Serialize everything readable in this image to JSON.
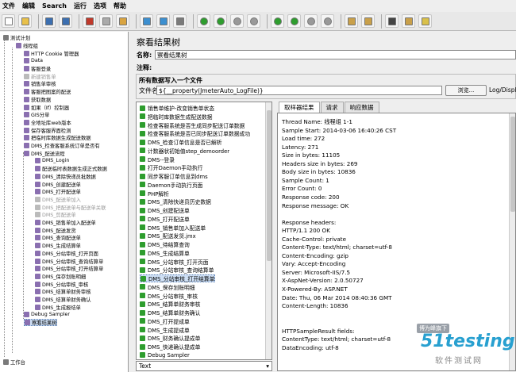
{
  "menu": {
    "file": "文件",
    "edit": "编辑",
    "search": "Search",
    "run": "运行",
    "options": "选项",
    "help": "帮助"
  },
  "toolbar": {
    "icons": [
      "new-icon",
      "open-icon",
      "save-icon",
      "save-as-icon",
      "cut-icon",
      "copy-icon",
      "paste-icon",
      "expand-icon",
      "collapse-icon",
      "toggle-icon",
      "start-icon",
      "start-no-pause-icon",
      "stop-icon",
      "shutdown-icon",
      "remote-start-icon",
      "remote-start-all-icon",
      "remote-stop-icon",
      "remote-shutdown-icon",
      "clear-icon",
      "clear-all-icon",
      "search-icon",
      "reset-search-icon",
      "function-helper-icon"
    ]
  },
  "tree": {
    "items": [
      {
        "label": "测试计划",
        "level": 0,
        "dim": false
      },
      {
        "label": "线程组",
        "level": 1,
        "dim": false
      },
      {
        "label": "HTTP Cookie 管理器",
        "level": 2,
        "dim": false
      },
      {
        "label": "Data",
        "level": 2,
        "dim": false
      },
      {
        "label": "客服登录",
        "level": 2,
        "dim": false
      },
      {
        "label": "新建销售单",
        "level": 2,
        "dim": true
      },
      {
        "label": "销售单审核",
        "level": 2,
        "dim": false
      },
      {
        "label": "客服把图案的配送",
        "level": 2,
        "dim": false
      },
      {
        "label": "获取数据",
        "level": 2,
        "dim": false
      },
      {
        "label": "如果（If）控制器",
        "level": 2,
        "dim": false
      },
      {
        "label": "GIS分单",
        "level": 2,
        "dim": false
      },
      {
        "label": "全地址库web版本",
        "level": 2,
        "dim": false
      },
      {
        "label": "保存客服界面检测",
        "level": 2,
        "dim": false
      },
      {
        "label": "把临时库数据生成配送数据",
        "level": 2,
        "dim": false
      },
      {
        "label": "DMS_检查客服系统订单是否有",
        "level": 2,
        "dim": false
      },
      {
        "label": "DMS_配送流程",
        "level": 2,
        "dim": false
      },
      {
        "label": "DMS_Login",
        "level": 3,
        "dim": false
      },
      {
        "label": "配送临时表数据生成正式数据",
        "level": 3,
        "dim": false
      },
      {
        "label": "DMS_清除快递员批数据",
        "level": 3,
        "dim": false
      },
      {
        "label": "DMS_创建配送单",
        "level": 3,
        "dim": false
      },
      {
        "label": "DMS_打开配送单",
        "level": 3,
        "dim": false
      },
      {
        "label": "DMS_配送单加入",
        "level": 3,
        "dim": true
      },
      {
        "label": "DMS_把配送单与配送单关联",
        "level": 3,
        "dim": true
      },
      {
        "label": "DMS_剪配送单",
        "level": 3,
        "dim": true
      },
      {
        "label": "DMS_销售单加入配送单",
        "level": 3,
        "dim": false
      },
      {
        "label": "DMS_配送发货",
        "level": 3,
        "dim": false
      },
      {
        "label": "DMS_查询配送单",
        "level": 3,
        "dim": false
      },
      {
        "label": "DMS_生成结算单",
        "level": 3,
        "dim": false
      },
      {
        "label": "DMS_分站审核_打开页面",
        "level": 3,
        "dim": false
      },
      {
        "label": "DMS_分站审核_查询结算单",
        "level": 3,
        "dim": false
      },
      {
        "label": "DMS_分站审核_打开结算单",
        "level": 3,
        "dim": false
      },
      {
        "label": "DMS_保存划账明细",
        "level": 3,
        "dim": false
      },
      {
        "label": "DMS_分站审核_审核",
        "level": 3,
        "dim": false
      },
      {
        "label": "DMS_结算单财务审核",
        "level": 3,
        "dim": false
      },
      {
        "label": "DMS_结算单财务确认",
        "level": 3,
        "dim": false
      },
      {
        "label": "DMS_生成报结单",
        "level": 3,
        "dim": false
      },
      {
        "label": "Debug Sampler",
        "level": 2,
        "dim": false
      },
      {
        "label": "察看结果树",
        "level": 2,
        "dim": false,
        "selected": true
      },
      {
        "label": "工作台",
        "level": 0,
        "dim": false
      }
    ]
  },
  "panel": {
    "title": "察看结果树",
    "name_label": "名称:",
    "name_value": "察看结果树",
    "comment_label": "注释:",
    "group_title": "所有数据写入一个文件",
    "file_label": "文件名",
    "file_value": "${__property(JmeterAuto_LogFile)}",
    "browse_button": "浏览...",
    "log_label": "Log/Display"
  },
  "results": {
    "items": [
      {
        "label": "销售单维护-改变销售单状态"
      },
      {
        "label": "把临时库数据生成配送数据"
      },
      {
        "label": "检查客服系统是否生成同步配送订单数据"
      },
      {
        "label": "检查客服系统是否已同步配送订单数据成功"
      },
      {
        "label": "DMS_检查订单信息是否已解析"
      },
      {
        "label": "计数器状初始值step_demoorder"
      },
      {
        "label": "DMS--登录"
      },
      {
        "label": "打开Daemon手动执行"
      },
      {
        "label": "同步客服订单信息到dms"
      },
      {
        "label": "Daemon手动执行页面"
      },
      {
        "label": "PHP解析"
      },
      {
        "label": "DMS_清除快递员历史数据"
      },
      {
        "label": "DMS_创建配送单"
      },
      {
        "label": "DMS_打开配送单"
      },
      {
        "label": "DMS_销售单加入配送单"
      },
      {
        "label": "DMS_配送发货.jmx"
      },
      {
        "label": "DMS_待结算查询"
      },
      {
        "label": "DMS_生成结算单"
      },
      {
        "label": "DMS_分站审核_打开页面"
      },
      {
        "label": "DMS_分站审核_查询结算单"
      },
      {
        "label": "DMS_分站审核_打开结算单",
        "selected": true
      },
      {
        "label": "DMS_保存划账明细"
      },
      {
        "label": "DMS_分站审核_审核"
      },
      {
        "label": "DMS_结算单财务审核"
      },
      {
        "label": "DMS_结算单财务确认"
      },
      {
        "label": "DMS_打开提成单"
      },
      {
        "label": "DMS_生成提成单"
      },
      {
        "label": "DMS_财务确认提成单"
      },
      {
        "label": "DMS_快递确认提成单"
      },
      {
        "label": "Debug Sampler"
      }
    ],
    "combo": "Text"
  },
  "tabs": [
    "取样器结果",
    "请求",
    "响应数据"
  ],
  "detail": {
    "lines": [
      "Thread Name: 线程组 1-1",
      "Sample Start: 2014-03-06 16:40:26 CST",
      "Load time: 272",
      "Latency: 271",
      "Size in bytes: 11105",
      "Headers size in bytes: 269",
      "Body size in bytes: 10836",
      "Sample Count: 1",
      "Error Count: 0",
      "Response code: 200",
      "Response message: OK",
      "",
      "Response headers:",
      "HTTP/1.1 200 OK",
      "Cache-Control: private",
      "Content-Type: text/html; charset=utf-8",
      "Content-Encoding: gzip",
      "Vary: Accept-Encoding",
      "Server: Microsoft-IIS/7.5",
      "X-AspNet-Version: 2.0.50727",
      "X-Powered-By: ASP.NET",
      "Date: Thu, 06 Mar 2014 08:40:36 GMT",
      "Content-Length: 10836",
      "",
      "",
      "HTTPSampleResult fields:",
      "ContentType: text/html; charset=utf-8",
      "DataEncoding: utf-8"
    ]
  },
  "watermark": {
    "badge": "博为峰旗下",
    "brand": "51testing",
    "cn": "软件测试网"
  }
}
